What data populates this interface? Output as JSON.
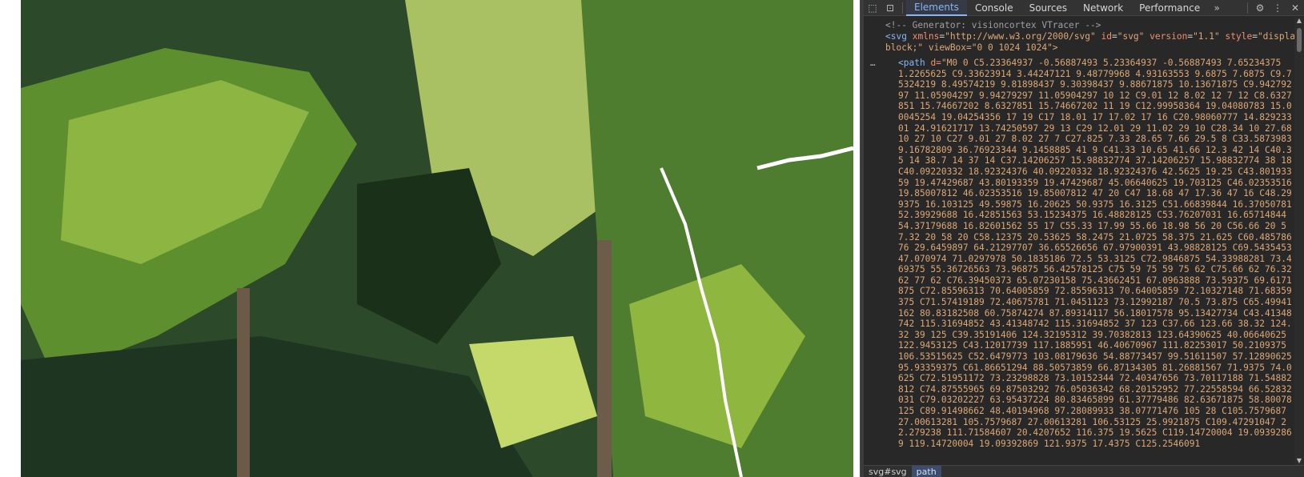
{
  "viewport": {
    "colors": {
      "deep": "#1f3a22",
      "mid": "#3f6b2c",
      "leaf": "#6e9a3a",
      "light": "#b9d36a",
      "sky": "#d9e2d4",
      "trunk": "#5b4a3a"
    }
  },
  "devtools": {
    "toolbar": {
      "inspect_icon": "⬚",
      "device_icon": "⊡",
      "tabs": [
        "Elements",
        "Console",
        "Sources",
        "Network",
        "Performance"
      ],
      "more_tabs": "»",
      "settings_icon": "⚙",
      "menu_icon": "⋮",
      "close_icon": "✕"
    },
    "dom": {
      "comment": "<!-- Generator: visioncortex VTracer -->",
      "svg_tag_open": "<svg",
      "svg_attrs": [
        {
          "name": "xmlns",
          "value": "\"http://www.w3.org/2000/svg\""
        },
        {
          "name": "id",
          "value": "\"svg\""
        },
        {
          "name": "version",
          "value": "\"1.1\""
        },
        {
          "name": "style",
          "value": "\"display:"
        }
      ],
      "svg_line2": "block;\" viewBox=\"0 0 1024 1024\">",
      "ellipsis": "…",
      "path_tag": "<path",
      "path_attr": "d=",
      "path_data": "\"M0 0 C5.23364937 -0.56887493 5.23364937 -0.56887493 7.65234375 1.2265625 C9.33623914 3.44247121 9.48779968 4.93163553 9.6875 7.6875 C9.75324219 8.49574219 9.81898437 9.30398437 9.88671875 10.13671875 C9.94279297 11.05904297 9.94279297 11.05904297 10 12 C9.01 12 8.02 12 7 12 C8.6327851 15.74667202 8.6327851 15.74667202 11 19 C12.99958364 19.04080783 15.00045254 19.04254356 17 19 C17 18.01 17 17.02 17 16 C20.98060777 14.82923301 24.91621717 13.74250597 29 13 C29 12.01 29 11.02 29 10 C28.34 10 27.68 10 27 10 C27 9.01 27 8.02 27 7 C27.825 7.33 28.65 7.66 29.5 8 C33.5873983 9.16782809 36.76923344 9.1458885 41 9 C41.33 10.65 41.66 12.3 42 14 C40.35 14 38.7 14 37 14 C37.14206257 15.98832774 37.14206257 15.98832774 38 18 C40.09220332 18.92324376 40.09220332 18.92324376 42.5625 19.25 C43.80193359 19.47429687 43.80193359 19.47429687 45.06640625 19.703125 C46.02353516 19.85007812 46.02353516 19.85007812 47 20 C47 18.68 47 17.36 47 16 C48.299375 16.103125 49.59875 16.20625 50.9375 16.3125 C51.66839844 16.37050781 52.39929688 16.42851563 53.15234375 16.48828125 C53.76207031 16.65714844 54.37179688 16.82601562 55 17 C55.33 17.99 55.66 18.98 56 20 C56.66 20 57.32 20 58 20 C58.12375 20.53625 58.2475 21.0725 58.375 21.625 C60.48578676 29.6459897 64.21297707 36.65526656 67.97900391 43.98828125 C69.5435453 47.070974 71.0297978 50.1835186 72.5 53.3125 C72.9846875 54.33988281 73.469375 55.36726563 73.96875 56.42578125 C75 59 75 59 75 62 C75.66 62 76.32 62 77 62 C76.39450373 65.07230158 75.43662451 67.0963888 73.59375 69.6171875 C72.85596313 70.64005859 72.85596313 70.64005859 72.10327148 71.68359375 C71.57419189 72.40675781 71.0451123 73.12992187 70.5 73.875 C65.49941162 80.83182508 60.75874274 87.89314117 56.18017578 95.13427734 C43.41348742 115.31694852 43.41348742 115.31694852 37 123 C37.66 123.66 38.32 124.32 39 125 C39.35191406 124.32195312 39.70382813 123.64390625 40.06640625 122.9453125 C43.12017739 117.1885951 46.40670967 111.82253017 50.2109375 106.53515625 C52.6479773 103.08179636 54.88773457 99.51611507 57.12890625 95.93359375 C61.86651294 88.50573859 66.87134305 81.26881567 71.9375 74.0625 C72.51951172 73.23298828 73.10152344 72.40347656 73.70117188 71.54882812 C74.87555965 69.87503292 76.05036342 68.20152952 77.22558594 66.52832031 C79.03202227 63.95437224 80.83465899 61.37779486 82.63671875 58.80078125 C89.91498662 48.40194968 97.28089933 38.07771476 105 28 C105.7579687 27.00613281 105.7579687 27.00613281 106.53125 25.9921875 C109.47291047 22.279238 111.71584607 20.4207652 116.375 19.5625 C119.14720004 19.09392869 119.14720004 19.09392869 121.9375 17.4375 C125.2546091"
    },
    "breadcrumb": [
      "svg#svg",
      "path"
    ]
  }
}
